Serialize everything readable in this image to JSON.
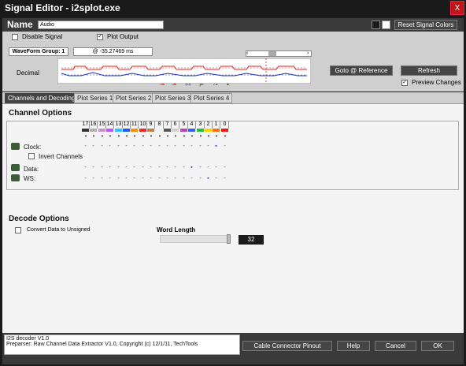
{
  "window": {
    "title": "Signal Editor - i2splot.exe",
    "close_label": "X"
  },
  "namebar": {
    "label": "Name",
    "value": "Audio",
    "reset_colors_label": "Reset Signal Colors",
    "swatch_colors": [
      "#1a1a1a",
      "#ffffff"
    ]
  },
  "options": {
    "disable_signal_label": "Disable Signal",
    "disable_signal_checked": false,
    "plot_output_label": "Plot Output",
    "plot_output_checked": true,
    "waveform_group_label": "WaveForm Group: 1",
    "time_readout": "@ -35.27469 ms",
    "decimal_label": "Decimal",
    "goto_reference_label": "Goto @ Reference",
    "refresh_label": "Refresh",
    "preview_changes_label": "Preview Changes",
    "preview_changes_checked": true,
    "waveform_colors": {
      "red": "#e02020",
      "blue": "#2030c0"
    }
  },
  "tabs": [
    {
      "label": "Channels and Decoding",
      "active": true
    },
    {
      "label": "Plot Series 1",
      "active": false
    },
    {
      "label": "Plot Series 2",
      "active": false
    },
    {
      "label": "Plot Series 3",
      "active": false
    },
    {
      "label": "Plot Series 4",
      "active": false
    }
  ],
  "channels": {
    "title": "Channel Options",
    "columns": [
      "17",
      "16",
      "15",
      "14",
      "13",
      "12",
      "11",
      "10",
      "9",
      "8",
      "7",
      "6",
      "5",
      "4",
      "3",
      "2",
      "1",
      "0"
    ],
    "column_colors": [
      "#333333",
      "#b0b0b0",
      "#d090d0",
      "#c050ff",
      "#30c0ff",
      "#1a5bff",
      "#ff8c00",
      "#ff2020",
      "#c08040",
      "#f0f0f0",
      "#555555",
      "#d0d0d0",
      "#c040c0",
      "#3060ff",
      "#20c040",
      "#ffd000",
      "#ff7010",
      "#ff1010"
    ],
    "rows": [
      {
        "label": "Clock:",
        "selected": 1
      },
      {
        "label": "Data:",
        "selected": 4
      },
      {
        "label": "WS:",
        "selected": 2
      }
    ],
    "invert_channels_label": "Invert Channels",
    "invert_channels_checked": false
  },
  "decode": {
    "title": "Decode Options",
    "convert_unsigned_label": "Convert Data to Unsigned",
    "convert_unsigned_checked": false,
    "word_length_label": "Word Length",
    "word_length_value": "32"
  },
  "footer": {
    "info_line1": "I2S decoder V1.0",
    "info_line2": "Preparser: Raw Channel Data Extractor V1.0, Copyright (c) 12/1/11, TechTools",
    "cable_label": "Cable Connector Pinout",
    "help_label": "Help",
    "cancel_label": "Cancel",
    "ok_label": "OK"
  }
}
